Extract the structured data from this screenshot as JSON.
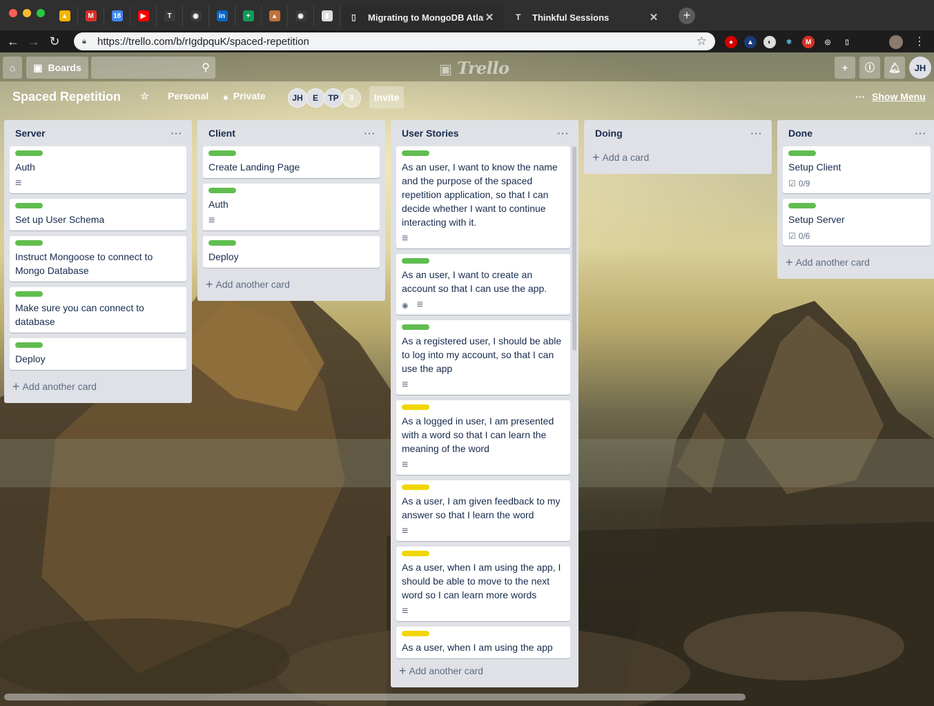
{
  "browser": {
    "pinned_tabs": [
      {
        "icon": "google-drive-icon",
        "color": "#f4b400",
        "text": "▲"
      },
      {
        "icon": "gmail-icon",
        "color": "#d93025",
        "text": "M"
      },
      {
        "icon": "calendar-icon",
        "color": "#4285f4",
        "text": "18"
      },
      {
        "icon": "youtube-icon",
        "color": "#ff0000",
        "text": "▶"
      },
      {
        "icon": "thinkful-icon",
        "color": "#3a3a3a",
        "text": "T"
      },
      {
        "icon": "github-icon",
        "color": "#3a3a3a",
        "text": "◉"
      },
      {
        "icon": "linkedin-icon",
        "color": "#0a66c2",
        "text": "in"
      },
      {
        "icon": "sheets-icon",
        "color": "#0f9d58",
        "text": "+"
      },
      {
        "icon": "app-icon",
        "color": "#c0703a",
        "text": "▴"
      },
      {
        "icon": "github-icon",
        "color": "#3a3a3a",
        "text": "◉"
      },
      {
        "icon": "trello-icon",
        "color": "#dddddd",
        "text": "▮"
      }
    ],
    "tabs": [
      {
        "title": "Migrating to MongoDB Atlas | r",
        "active": true
      },
      {
        "title": "Thinkful Sessions",
        "active": false
      }
    ],
    "url": "https://trello.com/b/rIgdpquK/spaced-repetition",
    "new_tab": "+"
  },
  "header": {
    "boards_label": "Boards",
    "search_placeholder": "",
    "logo": "Trello",
    "user_initials": "JH"
  },
  "board": {
    "title": "Spaced Repetition",
    "team": "Personal",
    "visibility": "Private",
    "members": [
      "JH",
      "E",
      "TP"
    ],
    "member_count": "3",
    "invite_label": "Invite",
    "show_menu_label": "Show Menu"
  },
  "lists": [
    {
      "title": "Server",
      "add_label": "Add another card",
      "cards": [
        {
          "title": "Auth",
          "label": "green",
          "description": true
        },
        {
          "title": "Set up User Schema",
          "label": "green"
        },
        {
          "title": "Instruct Mongoose to connect to Mongo Database",
          "label": "green"
        },
        {
          "title": "Make sure you can connect to database",
          "label": "green"
        },
        {
          "title": "Deploy",
          "label": "green"
        }
      ]
    },
    {
      "title": "Client",
      "add_label": "Add another card",
      "cards": [
        {
          "title": "Create Landing Page",
          "label": "green"
        },
        {
          "title": "Auth",
          "label": "green",
          "description": true
        },
        {
          "title": "Deploy",
          "label": "green"
        }
      ]
    },
    {
      "title": "User Stories",
      "add_label": "Add another card",
      "cards": [
        {
          "title": "As an user, I want to know the name and the purpose of the spaced repetition application, so that I can decide whether I want to continue interacting with it.",
          "label": "green",
          "description": true
        },
        {
          "title": "As an user, I want to create an account so that I can use the app.",
          "label": "green",
          "watch": true,
          "description": true
        },
        {
          "title": "As a registered user, I should be able to log into my account, so that I can use the app",
          "label": "green",
          "description": true
        },
        {
          "title": "As a logged in user, I am presented with a word so that I can learn the meaning of the word",
          "label": "yellow",
          "description": true
        },
        {
          "title": "As a user, I am given feedback to my answer so that I learn the word",
          "label": "yellow",
          "description": true
        },
        {
          "title": "As a user, when I am using the app, I should be able to move to the next word so I can learn more words",
          "label": "yellow",
          "description": true
        },
        {
          "title": "As a user, when I am using the app",
          "label": "yellow"
        }
      ]
    },
    {
      "title": "Doing",
      "add_label": "Add a card",
      "cards": []
    },
    {
      "title": "Done",
      "add_label": "Add another card",
      "cards": [
        {
          "title": "Setup Client",
          "label": "green",
          "checklist": "0/9"
        },
        {
          "title": "Setup Server",
          "label": "green",
          "checklist": "0/6"
        }
      ]
    }
  ],
  "colors": {
    "label_green": "#61bd4f",
    "label_yellow": "#f2d600",
    "list_bg": "#dfe1e6"
  }
}
